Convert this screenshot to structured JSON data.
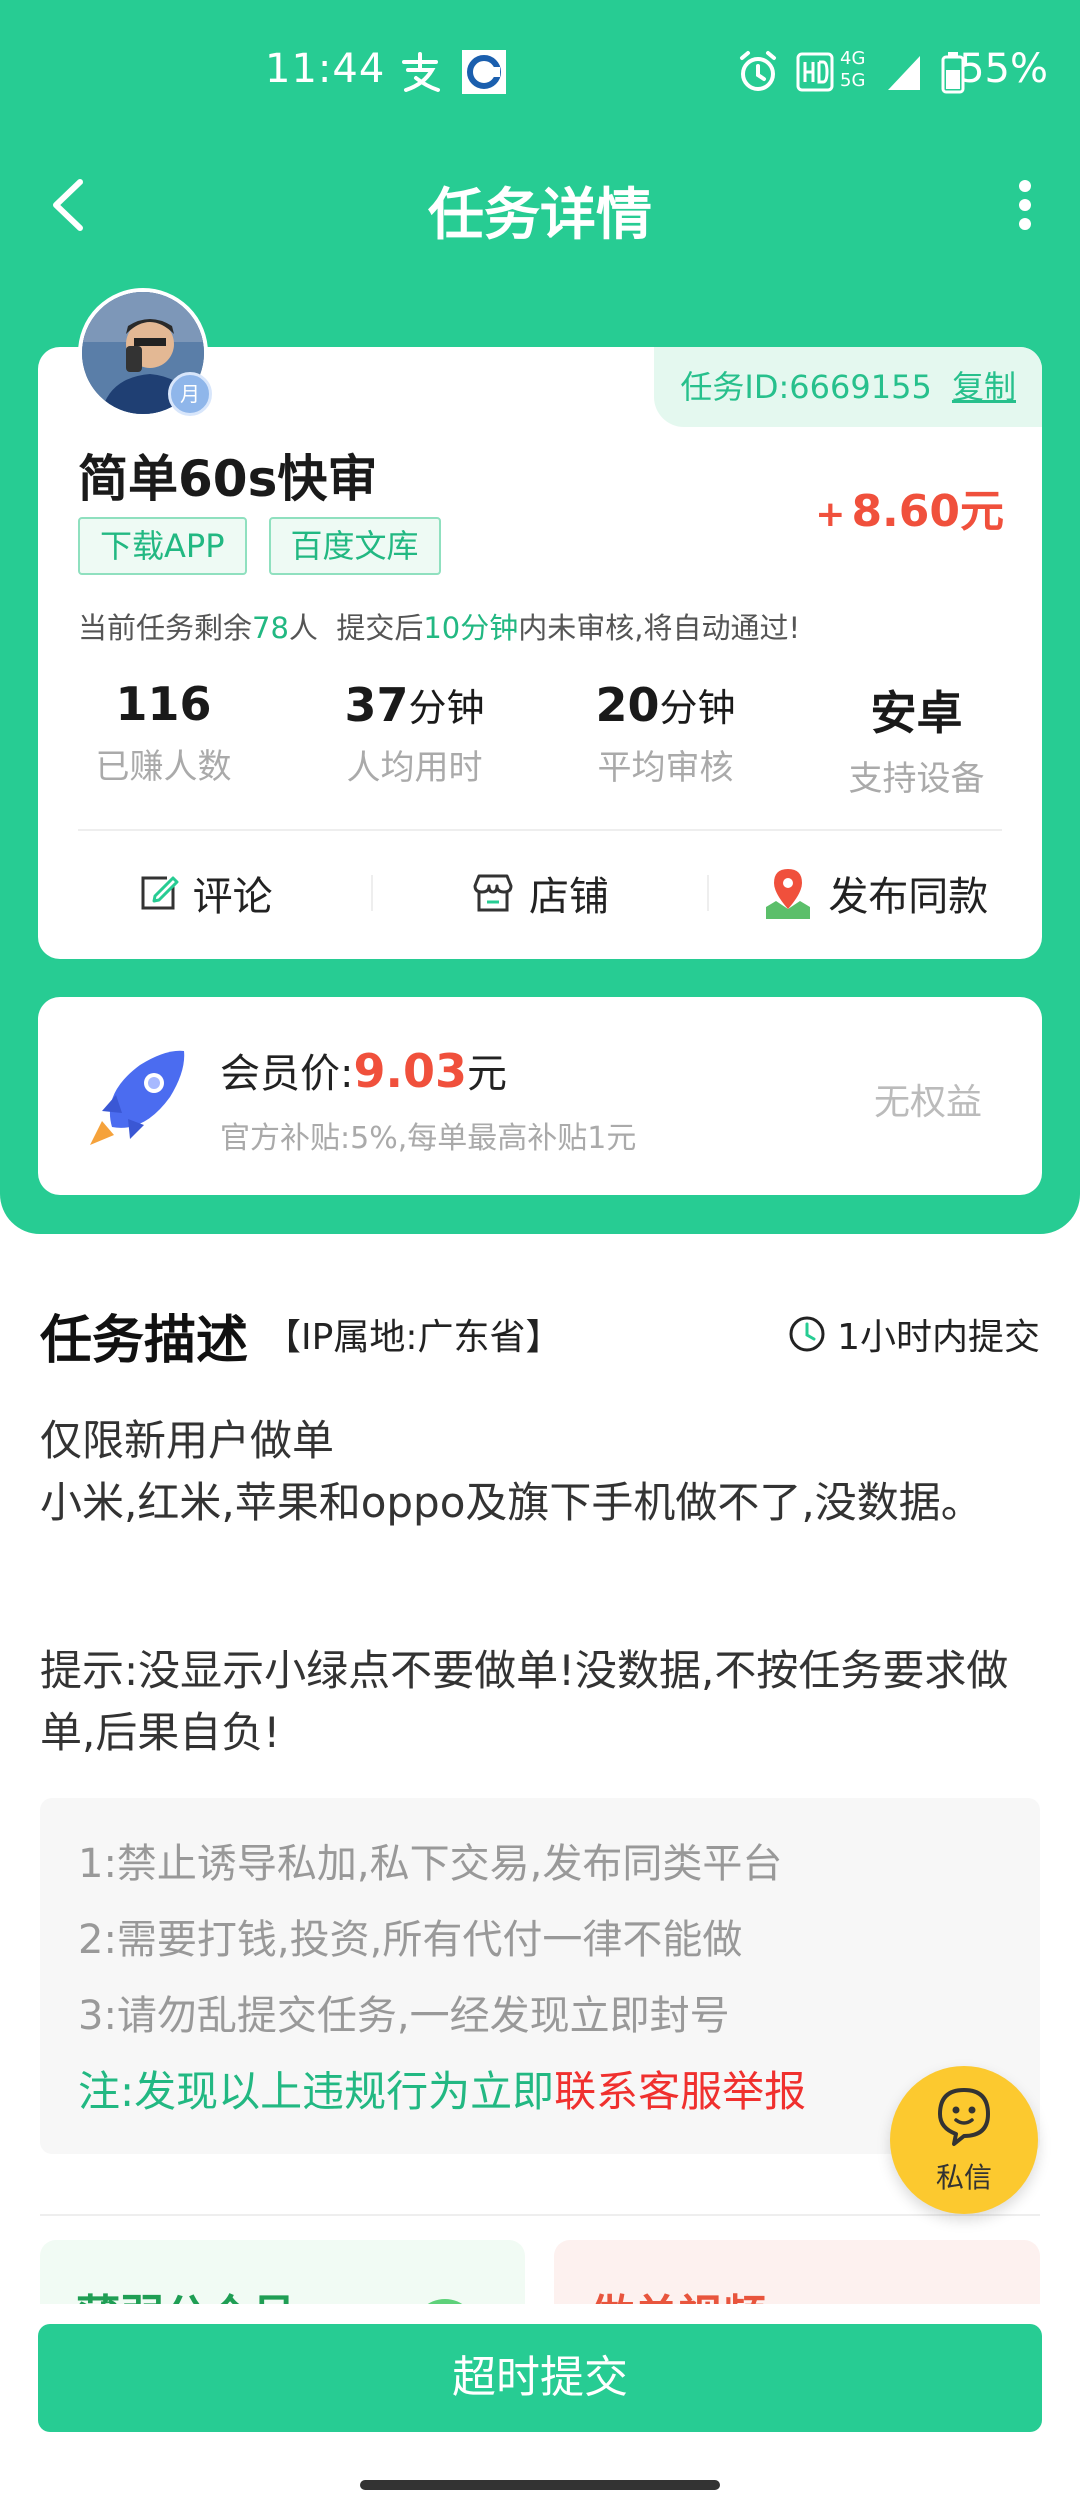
{
  "status_bar": {
    "time": "11:44",
    "network": "4G 5G",
    "battery": "55%"
  },
  "nav": {
    "title": "任务详情"
  },
  "task": {
    "id_label": "任务ID:6669155",
    "copy_label": "复制",
    "title": "简单60s快审",
    "reward_sign": "+",
    "reward": "8.60元",
    "tags": [
      "下载APP",
      "百度文库"
    ],
    "hint_prefix": "当前任务剩余",
    "hint_count": "78",
    "hint_mid": "人  提交后",
    "hint_time": "10分钟",
    "hint_suffix": "内未审核,将自动通过!",
    "avatar_badge": "月",
    "stats": [
      {
        "value": "116",
        "unit": "",
        "label": "已赚人数"
      },
      {
        "value": "37",
        "unit": "分钟",
        "label": "人均用时"
      },
      {
        "value": "20",
        "unit": "分钟",
        "label": "平均审核"
      },
      {
        "value": "安卓",
        "unit": "",
        "label": "支持设备"
      }
    ],
    "actions": {
      "comment": "评论",
      "shop": "店铺",
      "publish_same": "发布同款"
    }
  },
  "member": {
    "price_label": "会员价:",
    "price_value": "9.03",
    "price_unit": "元",
    "subtitle": "官方补贴:5%,每单最高补贴1元",
    "rights": "无权益"
  },
  "description": {
    "title": "任务描述",
    "ip": "【IP属地:广东省】",
    "deadline": "1小时内提交",
    "lines": [
      "仅限新用户做单",
      "小米,红米,苹果和oppo及旗下手机做不了,没数据。"
    ],
    "tip": "提示:没显示小绿点不要做单!没数据,不按任务要求做单,后果自负!",
    "rules": [
      "1:禁止诱导私加,私下交易,发布同类平台",
      "2:需要打钱,投资,所有代付一律不能做",
      "3:请勿乱提交任务,一经发现立即封号"
    ],
    "note_prefix": "注:发现以上违规行为立即",
    "note_link": "联系客服举报"
  },
  "promos": {
    "left": "薄弱公众号",
    "right": "做单视频"
  },
  "dm": {
    "label": "私信"
  },
  "bottom": {
    "submit": "超时提交"
  },
  "colors": {
    "primary": "#27cc93",
    "accent_red": "#f0503c",
    "dm_yellow": "#fcc92f"
  }
}
